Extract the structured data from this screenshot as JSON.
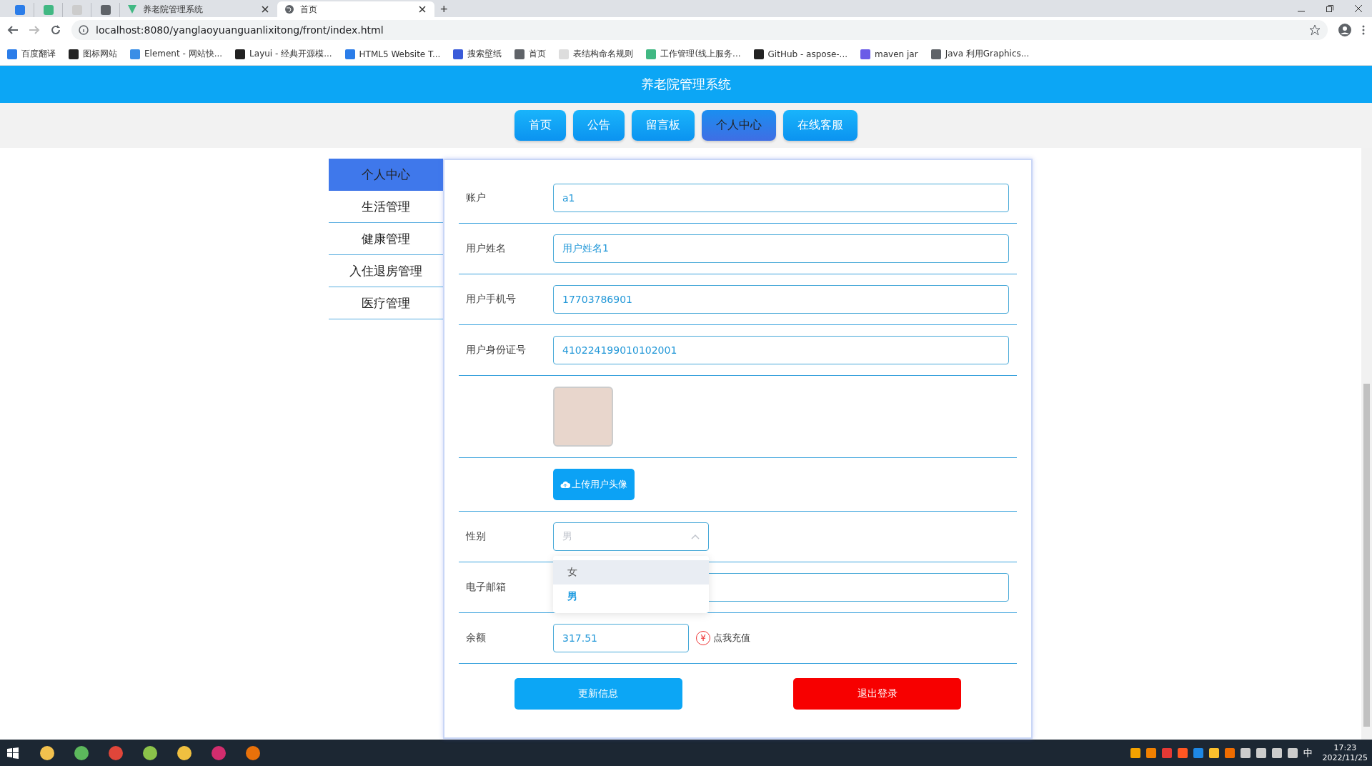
{
  "browser": {
    "tabs": [
      {
        "title": "养老院管理系统",
        "selected": false
      },
      {
        "title": "首页",
        "selected": true
      }
    ],
    "new_tab": "+",
    "address": "localhost:8080/yanglaoyuanguanlixitong/front/index.html",
    "bookmarks": [
      "百度翻译",
      "图标网站",
      "Element - 网站快...",
      "Layui - 经典开源模...",
      "HTML5 Website T...",
      "搜索壁纸",
      "首页",
      "表结构命名规则",
      "工作管理(线上服务...",
      "GitHub - aspose-...",
      "maven jar",
      "Java 利用Graphics..."
    ]
  },
  "header": {
    "title": "养老院管理系统"
  },
  "nav": [
    {
      "label": "首页",
      "selected": false
    },
    {
      "label": "公告",
      "selected": false
    },
    {
      "label": "留言板",
      "selected": false
    },
    {
      "label": "个人中心",
      "selected": true
    },
    {
      "label": "在线客服",
      "selected": false
    }
  ],
  "sidebar": [
    {
      "label": "个人中心",
      "selected": true
    },
    {
      "label": "生活管理",
      "selected": false
    },
    {
      "label": "健康管理",
      "selected": false
    },
    {
      "label": "入住退房管理",
      "selected": false
    },
    {
      "label": "医疗管理",
      "selected": false
    }
  ],
  "form": [
    {
      "kind": "text",
      "label": "账户",
      "value": "a1"
    },
    {
      "kind": "text",
      "label": "用户姓名",
      "value": "用户姓名1"
    },
    {
      "kind": "text",
      "label": "用户手机号",
      "value": "17703786901"
    },
    {
      "kind": "text",
      "label": "用户身份证号",
      "value": "410224199010102001"
    },
    {
      "kind": "avatar"
    },
    {
      "kind": "upload",
      "button": "上传用户头像"
    },
    {
      "kind": "select",
      "label": "性别",
      "placeholder": "男",
      "expanded": true,
      "options": [
        {
          "label": "女",
          "selected": false,
          "hovered": true
        },
        {
          "label": "男",
          "selected": true,
          "hovered": false
        }
      ]
    },
    {
      "kind": "text",
      "label": "电子邮箱"
    },
    {
      "kind": "balance",
      "label": "余额",
      "value": "317.51",
      "icon_text": "¥",
      "link": "点我充值"
    }
  ],
  "actions": [
    {
      "kind": "primary",
      "label": "更新信息"
    },
    {
      "kind": "danger",
      "label": "退出登录"
    }
  ],
  "taskbar": {
    "ime": "中",
    "time": "17:23",
    "date": "2022/11/25"
  }
}
